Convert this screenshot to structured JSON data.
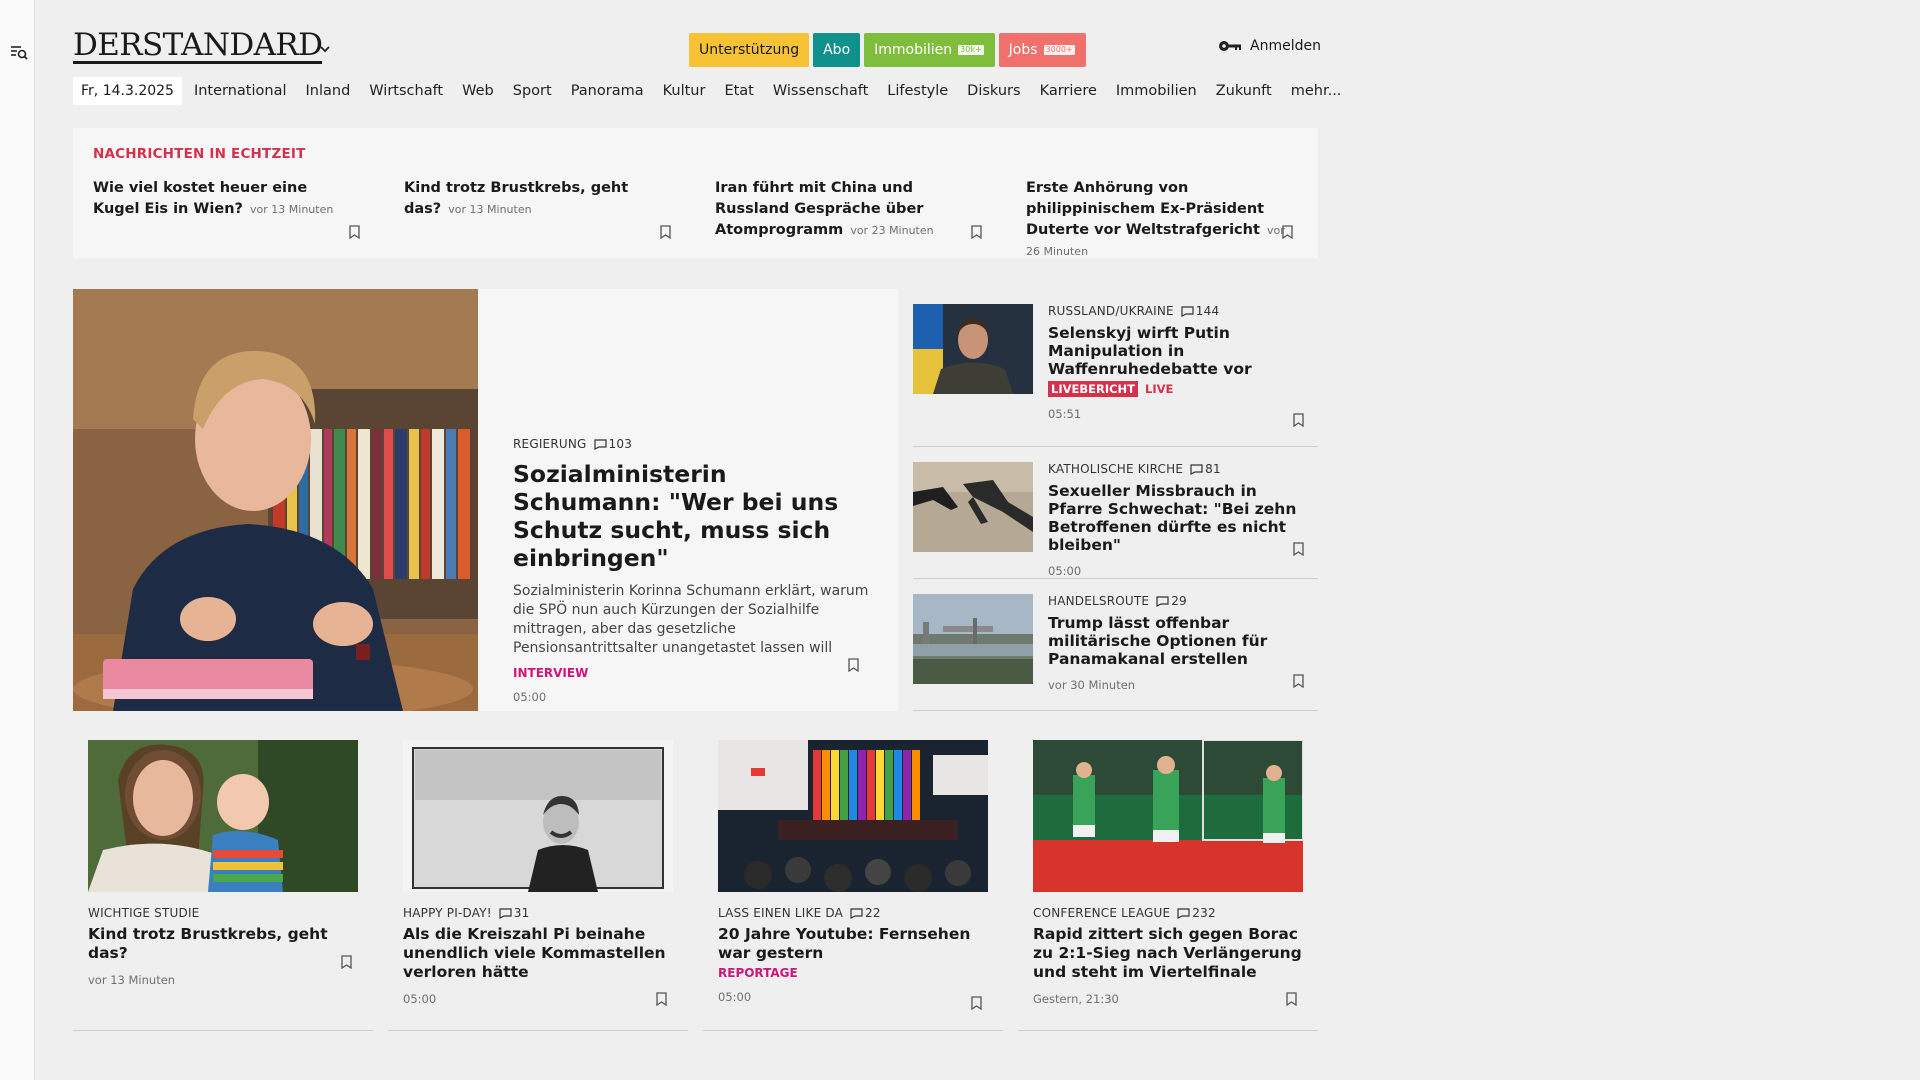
{
  "brand": {
    "logo_text": "DERSTANDARD"
  },
  "header_buttons": [
    {
      "label": "Unterstützung",
      "bg": "#f7c234",
      "fg": "#1a1a1a"
    },
    {
      "label": "Abo",
      "bg": "#10918c",
      "fg": "#ffffff"
    },
    {
      "label": "Immobilien",
      "badge": "30k+",
      "bg": "#7fbe3c",
      "fg": "#ffffff"
    },
    {
      "label": "Jobs",
      "badge": "3000+",
      "bg": "#f0716b",
      "fg": "#ffffff"
    }
  ],
  "login": {
    "label": "Anmelden"
  },
  "nav": {
    "date": "Fr, 14.3.2025",
    "items": [
      "International",
      "Inland",
      "Wirtschaft",
      "Web",
      "Sport",
      "Panorama",
      "Kultur",
      "Etat",
      "Wissenschaft",
      "Lifestyle",
      "Diskurs",
      "Karriere",
      "Immobilien",
      "Zukunft",
      "mehr..."
    ]
  },
  "ticker": {
    "title": "NACHRICHTEN IN ECHTZEIT",
    "items": [
      {
        "headline": "Wie viel kostet heuer eine Kugel Eis in Wien?",
        "time": "vor 13 Minuten"
      },
      {
        "headline": "Kind trotz Brustkrebs, geht das?",
        "time": "vor 13 Minuten"
      },
      {
        "headline": "Iran führt mit China und Russland Gespräche über Atomprogramm",
        "time": "vor 23 Minuten"
      },
      {
        "headline": "Erste Anhörung von philippinischem Ex-Präsident Duterte vor Weltstrafgericht",
        "time": "vor 26 Minuten"
      }
    ]
  },
  "lead": {
    "kicker": "REGIERUNG",
    "comments": "103",
    "title": "Sozialministerin Schumann: \"Wer bei uns Schutz sucht, muss sich einbringen\"",
    "teaser": "Sozialministerin Korinna Schumann erklärt, warum die SPÖ nun auch Kürzungen der Sozialhilfe mittragen, aber das gesetzliche Pensionsantrittsalter unangetastet lassen will",
    "tag": "INTERVIEW",
    "time": "05:00"
  },
  "side_stories": [
    {
      "kicker": "RUSSLAND/UKRAINE",
      "comments": "144",
      "title": "Selenskyj wirft Putin Manipulation in Waffenruhedebatte vor",
      "badge": "LIVEBERICHT",
      "live": "LIVE",
      "time": "05:51"
    },
    {
      "kicker": "KATHOLISCHE KIRCHE",
      "comments": "81",
      "title": "Sexueller Missbrauch in Pfarre Schwechat: \"Bei zehn Betroffenen dürfte es nicht bleiben\"",
      "time": "05:00"
    },
    {
      "kicker": "HANDELSROUTE",
      "comments": "29",
      "title": "Trump lässt offenbar militärische Optionen für Panamakanal erstellen",
      "time": "vor 30 Minuten"
    }
  ],
  "cards": [
    {
      "kicker": "WICHTIGE STUDIE",
      "title": "Kind trotz Brustkrebs, geht das?",
      "time": "vor 13 Minuten"
    },
    {
      "kicker": "HAPPY PI-DAY!",
      "comments": "31",
      "title": "Als die Kreiszahl Pi beinahe unendlich viele Kommastellen verloren hätte",
      "time": "05:00"
    },
    {
      "kicker": "LASS EINEN LIKE DA",
      "comments": "22",
      "title": "20 Jahre Youtube: Fernsehen war gestern",
      "tag": "REPORTAGE",
      "time": "05:00"
    },
    {
      "kicker": "CONFERENCE LEAGUE",
      "comments": "232",
      "title": "Rapid zittert sich gegen Borac zu 2:1-Sieg nach Verlängerung und steht im Viertelfinale",
      "time": "Gestern, 21:30"
    }
  ],
  "colors": {
    "accent_red": "#d3314c",
    "tag_pink": "#d0147b"
  },
  "icons": [
    "search-menu-icon",
    "chevron-down-icon",
    "key-icon",
    "comment-icon",
    "bookmark-icon"
  ]
}
